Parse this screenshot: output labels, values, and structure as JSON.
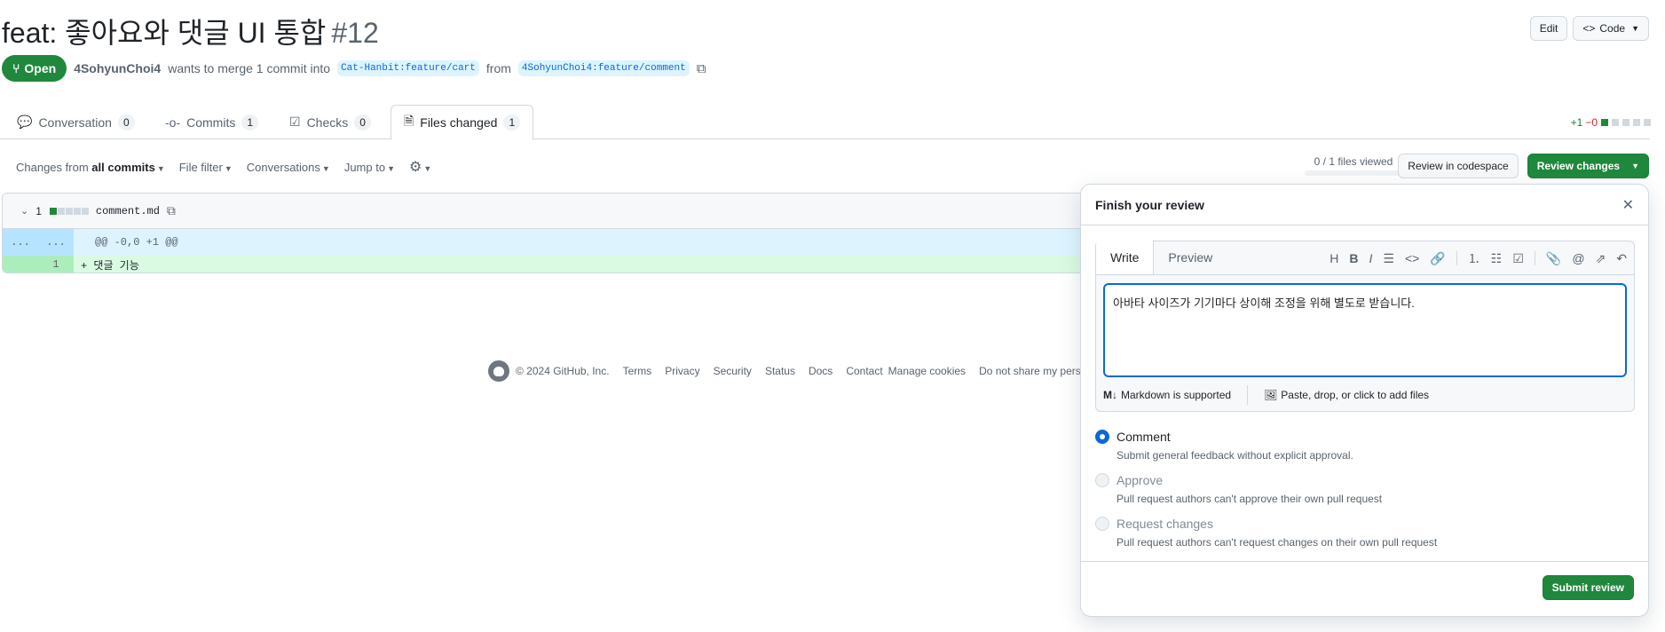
{
  "header": {
    "title": "feat: 좋아요와 댓글 UI 통합",
    "number": "#12",
    "edit_label": "Edit",
    "code_label": "Code"
  },
  "meta": {
    "state": "Open",
    "author": "4SohyunChoi4",
    "merge_text": "wants to merge 1 commit into",
    "base_branch": "Cat-Hanbit:feature/cart",
    "from_text": "from",
    "head_branch": "4SohyunChoi4:feature/comment"
  },
  "tabs": [
    {
      "label": "Conversation",
      "count": "0"
    },
    {
      "label": "Commits",
      "count": "1"
    },
    {
      "label": "Checks",
      "count": "0"
    },
    {
      "label": "Files changed",
      "count": "1"
    }
  ],
  "diffstat": {
    "additions": "+1",
    "deletions": "−0"
  },
  "toolbar": {
    "changes_prefix": "Changes from",
    "changes_value": "all commits",
    "file_filter": "File filter",
    "conversations": "Conversations",
    "jump_to": "Jump to",
    "files_viewed": "0 / 1 files viewed",
    "codespace_button": "Review in codespace",
    "review_button": "Review changes"
  },
  "file": {
    "changes": "1",
    "name": "comment.md",
    "hunk_expand_left": "...",
    "hunk_expand_right": "...",
    "hunk_header": "@@ -0,0 +1 @@",
    "line_number": "1",
    "line_content": "+ 댓글 기능"
  },
  "footer": {
    "copyright": "© 2024 GitHub, Inc.",
    "links": [
      "Terms",
      "Privacy",
      "Security",
      "Status",
      "Docs",
      "Contact",
      "Manage cookies",
      "Do not share my perso"
    ]
  },
  "review": {
    "title": "Finish your review",
    "write_tab": "Write",
    "preview_tab": "Preview",
    "body": "아바타  사이즈가 기기마다 상이해 조정을 위해 별도로 받습니다.",
    "markdown_note": "Markdown is supported",
    "attach_note": "Paste, drop, or click to add files",
    "options": [
      {
        "label": "Comment",
        "desc": "Submit general feedback without explicit approval."
      },
      {
        "label": "Approve",
        "desc": "Pull request authors can't approve their own pull request"
      },
      {
        "label": "Request changes",
        "desc": "Pull request authors can't request changes on their own pull request"
      }
    ],
    "submit": "Submit review"
  }
}
